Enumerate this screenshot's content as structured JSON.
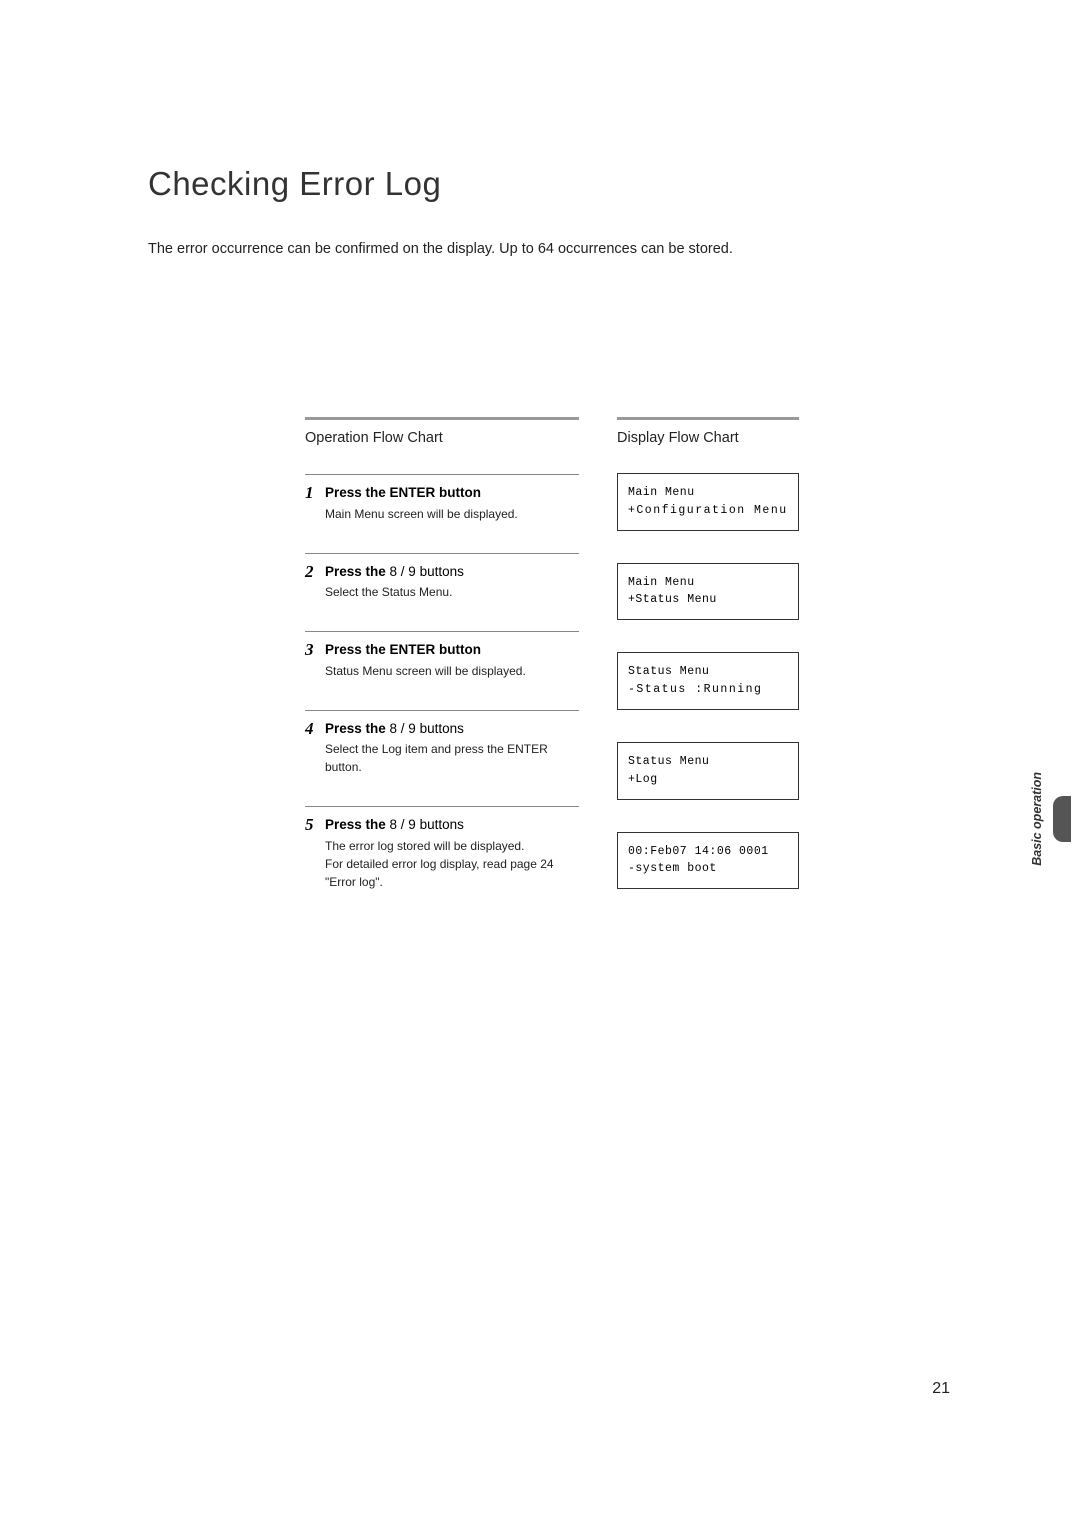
{
  "title": "Checking Error Log",
  "intro": "The error occurrence can be confirmed on the display. Up to 64 occurrences can be stored.",
  "left_header": "Operation Flow Chart",
  "right_header": "Display Flow Chart",
  "steps": [
    {
      "num": "1",
      "title_bold": "Press the ENTER button",
      "title_rest": "",
      "desc": "Main Menu screen will be displayed."
    },
    {
      "num": "2",
      "title_bold": "Press the",
      "title_rest": " 8 / 9 buttons",
      "desc": "Select the Status Menu."
    },
    {
      "num": "3",
      "title_bold": "Press the ENTER button",
      "title_rest": "",
      "desc": "Status Menu screen will be displayed."
    },
    {
      "num": "4",
      "title_bold": "Press the",
      "title_rest": " 8 / 9 buttons",
      "desc": "Select the Log item and press the ENTER button."
    },
    {
      "num": "5",
      "title_bold": "Press the",
      "title_rest": " 8 / 9 buttons",
      "desc": "The error log stored will be displayed.\nFor detailed error log display, read page 24 \"Error log\"."
    }
  ],
  "displays": [
    {
      "line1": "Main Menu",
      "line2": "+Configuration Menu"
    },
    {
      "line1": "Main Menu",
      "line2": "+Status Menu"
    },
    {
      "line1": "Status Menu",
      "line2": "-Status    :Running"
    },
    {
      "line1": "Status Menu",
      "line2": "+Log"
    },
    {
      "line1": "00:Feb07 14:06 0001",
      "line2": "-system boot"
    }
  ],
  "side_label": "Basic operation",
  "page_number": "21"
}
